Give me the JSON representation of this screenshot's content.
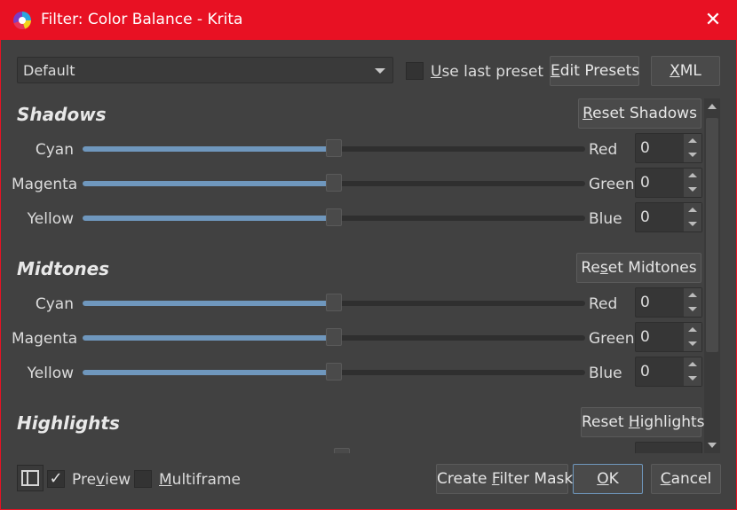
{
  "window": {
    "title": "Filter: Color Balance - Krita"
  },
  "top": {
    "preset_value": "Default",
    "use_last_preset": "Use last preset",
    "edit_presets": "Edit Presets",
    "xml": "XML"
  },
  "shadows": {
    "title": "Shadows",
    "reset": "Reset Shadows",
    "rows": [
      {
        "left": "Cyan",
        "right": "Red",
        "value": "0",
        "position": 0.5
      },
      {
        "left": "Magenta",
        "right": "Green",
        "value": "0",
        "position": 0.5
      },
      {
        "left": "Yellow",
        "right": "Blue",
        "value": "0",
        "position": 0.5
      }
    ]
  },
  "midtones": {
    "title": "Midtones",
    "reset": "Reset Midtones",
    "rows": [
      {
        "left": "Cyan",
        "right": "Red",
        "value": "0",
        "position": 0.5
      },
      {
        "left": "Magenta",
        "right": "Green",
        "value": "0",
        "position": 0.5
      },
      {
        "left": "Yellow",
        "right": "Blue",
        "value": "0",
        "position": 0.5
      }
    ]
  },
  "highlights": {
    "title": "Highlights",
    "reset": "Reset Highlights"
  },
  "bottom": {
    "preview": "Preview",
    "preview_checked": true,
    "multiframe": "Multiframe",
    "create_mask": "Create Filter Mask",
    "ok": "OK",
    "cancel": "Cancel"
  },
  "colors": {
    "titlebar": "#e81123",
    "background": "#414141",
    "slider_fill": "#6f97bd"
  }
}
